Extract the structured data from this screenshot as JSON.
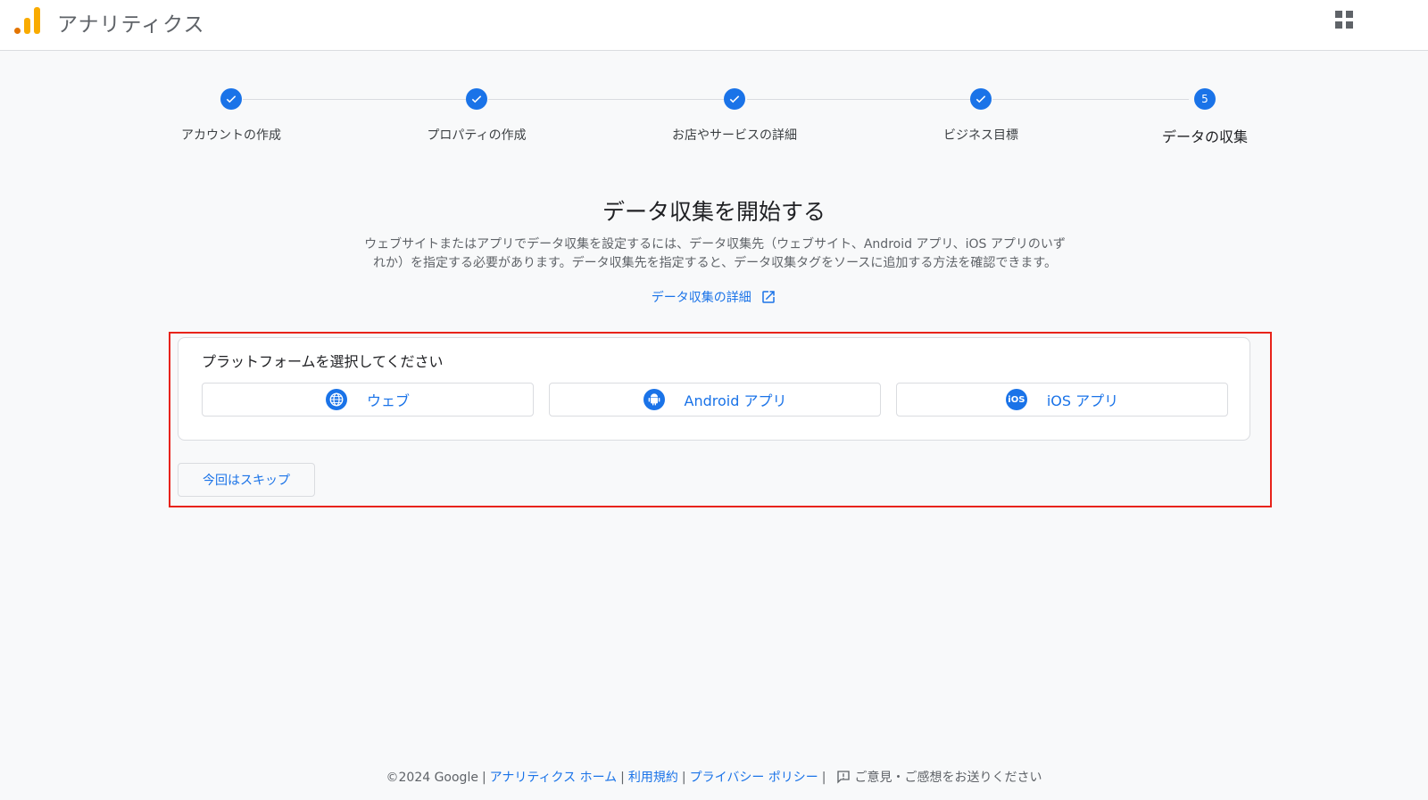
{
  "header": {
    "app_title": "アナリティクス",
    "logo_icon": "analytics-logo-icon",
    "apps_icon": "apps-grid-icon"
  },
  "stepper": {
    "steps": [
      {
        "label": "アカウントの作成",
        "status": "complete"
      },
      {
        "label": "プロパティの作成",
        "status": "complete"
      },
      {
        "label": "お店やサービスの詳細",
        "status": "complete"
      },
      {
        "label": "ビジネス目標",
        "status": "complete"
      },
      {
        "label": "データの収集",
        "status": "active",
        "number": "5"
      }
    ]
  },
  "main": {
    "title": "データ収集を開始する",
    "description_line1": "ウェブサイトまたはアプリでデータ収集を設定するには、データ収集先（ウェブサイト、Android アプリ、iOS アプリのいず",
    "description_line2": "れか）を指定する必要があります。データ収集先を指定すると、データ収集タグをソースに追加する方法を確認できます。",
    "learn_more": "データ収集の詳細",
    "platform_prompt": "プラットフォームを選択してください",
    "platforms": [
      {
        "label": "ウェブ",
        "icon": "globe-icon"
      },
      {
        "label": "Android アプリ",
        "icon": "android-icon"
      },
      {
        "label": "iOS アプリ",
        "icon": "ios-icon",
        "icon_text": "iOS"
      }
    ],
    "skip": "今回はスキップ"
  },
  "footer": {
    "copyright": "©2024 Google",
    "home": "アナリティクス ホーム",
    "terms": "利用規約",
    "privacy": "プライバシー ポリシー",
    "feedback": "ご意見・ご感想をお送りください"
  },
  "colors": {
    "accent": "#1a73e8",
    "highlight": "#e8231a",
    "logo_orange": "#f9ab00"
  }
}
